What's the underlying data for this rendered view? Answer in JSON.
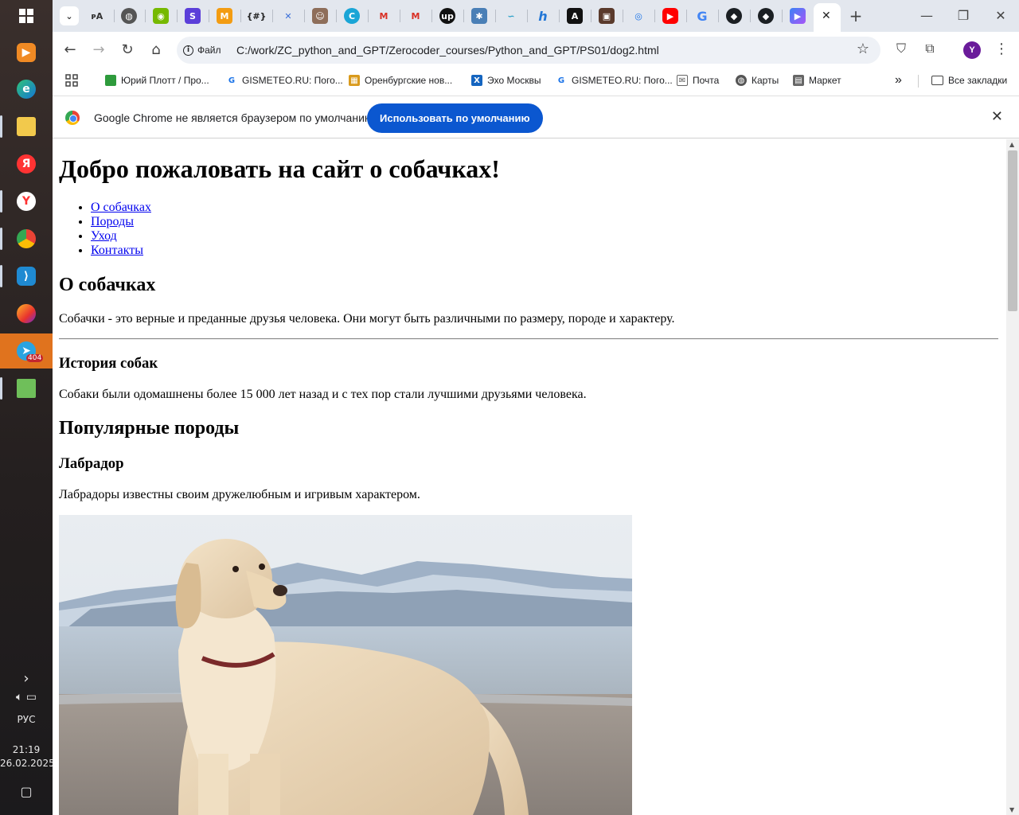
{
  "taskbar": {
    "tray_chevron": "›",
    "language": "РУС",
    "time": "21:19",
    "date": "26.02.2025",
    "telegram_badge": "404"
  },
  "tabs": {
    "active_close": "✕",
    "new_tab": "+",
    "list_label": "⌄"
  },
  "window": {
    "minimize": "—",
    "restore": "❐",
    "close": "✕"
  },
  "toolbar": {
    "back": "←",
    "forward": "→",
    "reload": "↻",
    "home": "⌂",
    "file_chip": "Файл",
    "url": "C:/work/ZC_python_and_GPT/Zerocoder_courses/Python_and_GPT/PS01/dog2.html",
    "star": "☆",
    "avatar": "Y",
    "menu": "⋮"
  },
  "bookmarks": {
    "items": [
      "Юрий Плотт / Про...",
      "GISMETEO.RU: Пого...",
      "Оренбургские нов...",
      "Эхо Москвы",
      "GISMETEO.RU: Пого...",
      "Почта",
      "Карты",
      "Маркет"
    ],
    "more": "»",
    "all": "Все закладки"
  },
  "infobar": {
    "text": "Google Chrome не является браузером по умолчанию.",
    "button": "Использовать по умолчанию",
    "close": "✕"
  },
  "page": {
    "h1": "Добро пожаловать на сайт о собачках!",
    "nav": [
      "О собачках",
      "Породы",
      "Уход",
      "Контакты"
    ],
    "about_h2": "О собачках",
    "about_p": "Собачки - это верные и преданные друзья человека. Они могут быть различными по размеру, породе и характеру.",
    "history_h3": "История собак",
    "history_p": "Собаки были одомашнены более 15 000 лет назад и с тех пор стали лучшими друзьями человека.",
    "breeds_h2": "Популярные породы",
    "labrador_h3": "Лабрадор",
    "labrador_p": "Лабрадоры известны своим дружелюбным и игривым характером."
  }
}
